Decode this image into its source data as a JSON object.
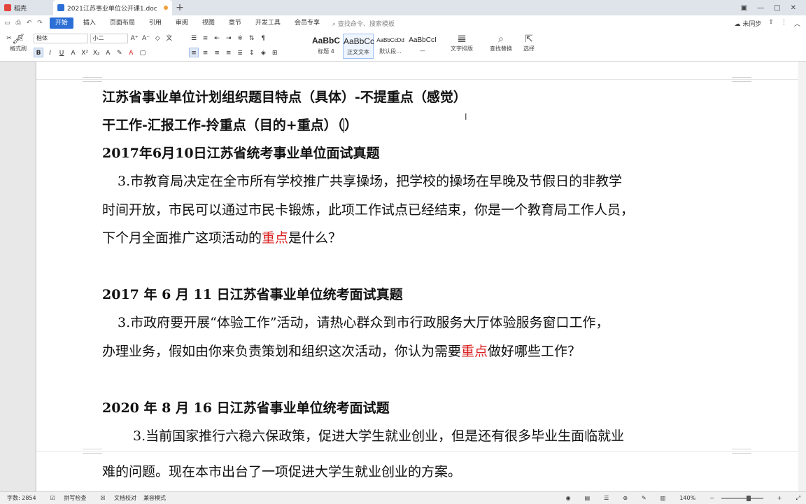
{
  "tabs": {
    "home_label": "稻壳",
    "doc_label": "2021江苏事业单位公开课1.doc",
    "new_tab": "+"
  },
  "menu": {
    "items": [
      "开始",
      "插入",
      "页面布局",
      "引用",
      "审阅",
      "视图",
      "章节",
      "开发工具",
      "会员专享"
    ],
    "search_placeholder": "查找命令、搜索模板",
    "sync_label": "未同步"
  },
  "ribbon": {
    "format_painter": "格式刷",
    "font_name": "楷体",
    "font_size": "小二",
    "styles": [
      {
        "preview": "AaBbC",
        "name": "标题 4"
      },
      {
        "preview": "AaBbCc",
        "name": "正文文本"
      },
      {
        "preview": "AaBbCcDd",
        "name": "默认段..."
      },
      {
        "preview": "AaBbCcI",
        "name": "—"
      }
    ],
    "text_layout": "文字排版",
    "find_replace": "查找替换",
    "select": "选择"
  },
  "document": {
    "line1": "江苏省事业单位计划组织题目特点（具体）-不提重点（感觉）",
    "line2_pre": "干工作-汇报工作-拎重点（目的+重点）（",
    "line2_post": "）",
    "h1": "2017年6月10日江苏省统考事业单位面试真题",
    "q1_a": "3.市教育局决定在全市所有学校推广共享操场，把学校的操场在早晚及节假日的非教学",
    "q1_b": "时间开放，市民可以通过市民卡锻炼，此项工作试点已经结束，你是一个教育局工作人员，",
    "q1_c_pre": "下个月全面推广这项活动的",
    "q1_c_red": "重点",
    "q1_c_post": "是什么？",
    "h2": "2017 年 6 月 11 日江苏省事业单位统考面试真题",
    "q2_a": "3.市政府要开展“体验工作”活动，请热心群众到市行政服务大厅体验服务窗口工作，",
    "q2_b_pre": "办理业务，假如由你来负责策划和组织这次活动，你认为需要",
    "q2_b_red": "重点",
    "q2_b_post": "做好哪些工作？",
    "h3": "2020 年 8 月 16 日江苏省事业单位统考面试题",
    "q3_a": "3.当前国家推行六稳六保政策，促进大学生就业创业，但是还有很多毕业生面临就业",
    "q3_b": "难的问题。现在本市出台了一项促进大学生就业创业的方案。"
  },
  "status": {
    "word_count": "字数: 2854",
    "spell_check": "拼写检查",
    "doc_proof": "文档校对",
    "compat_mode": "兼容模式",
    "zoom": "140%"
  },
  "colors": {
    "accent": "#2b6fd6",
    "highlight_red": "#d9201f"
  }
}
